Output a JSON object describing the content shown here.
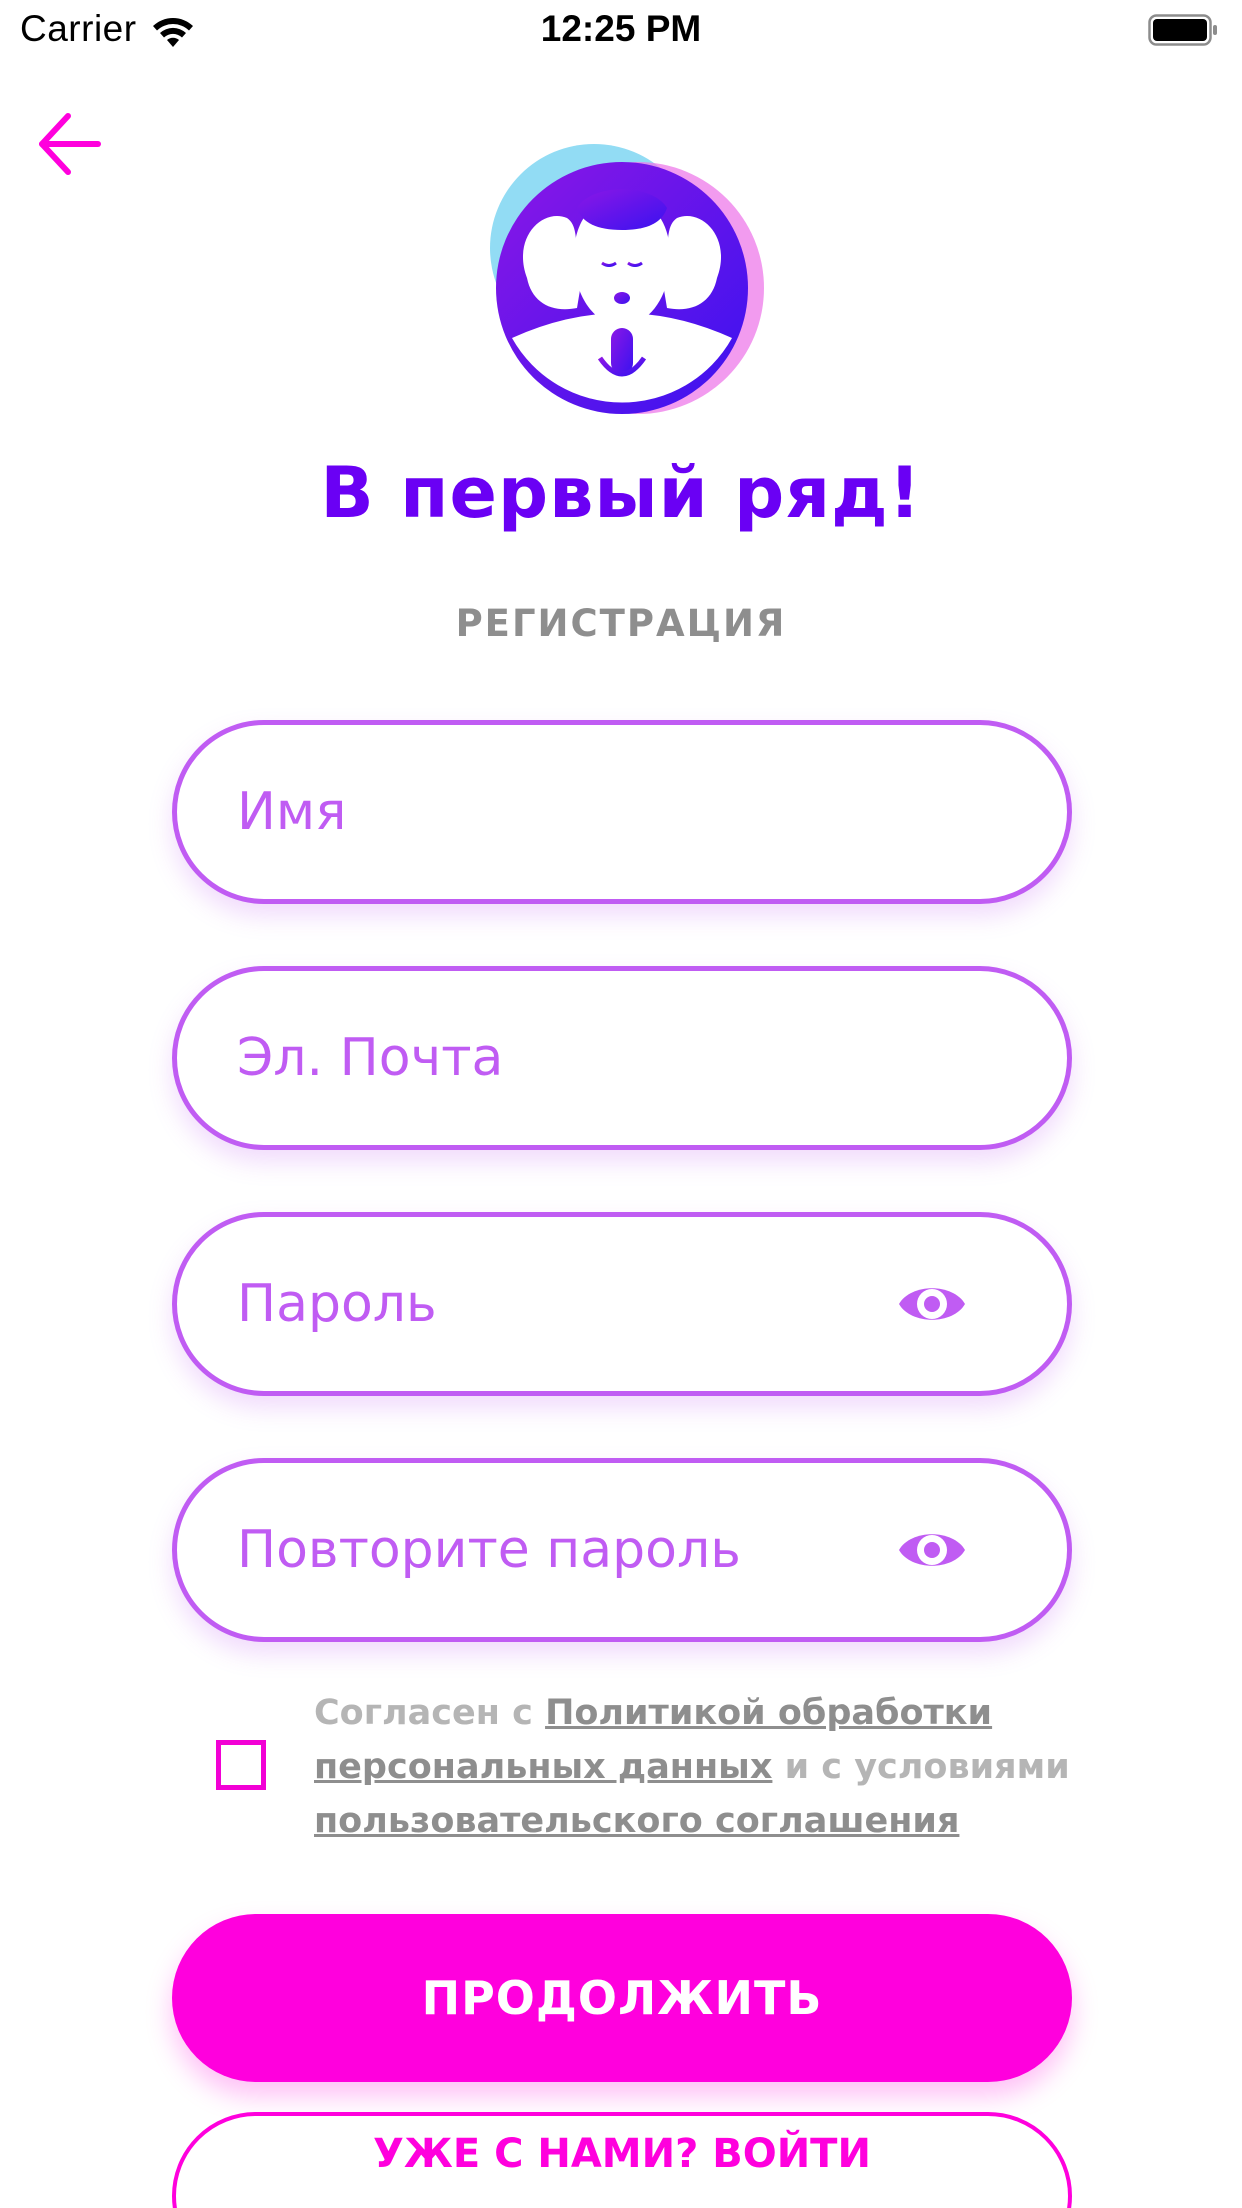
{
  "status_bar": {
    "carrier": "Carrier",
    "time": "12:25 PM"
  },
  "header": {
    "back_icon": "arrow-left-icon",
    "logo_icon": "singers-microphone-logo",
    "app_title": "В первый ряд!",
    "screen_title": "РЕГИСТРАЦИЯ"
  },
  "form": {
    "name_placeholder": "Имя",
    "name_value": "",
    "email_placeholder": "Эл. Почта",
    "email_value": "",
    "password_placeholder": "Пароль",
    "password_value": "",
    "repeat_password_placeholder": "Повторите пароль",
    "repeat_password_value": "",
    "eye_icon": "eye-icon"
  },
  "agreement": {
    "checked": false,
    "prefix": "Согласен с ",
    "policy_link": "Политикой обработки персональных данных",
    "middle": " и с условиями ",
    "terms_link": "пользовательского соглашения"
  },
  "actions": {
    "continue_label": "ПРОДОЛЖИТЬ",
    "login_label": "УЖЕ С НАМИ? ВОЙТИ"
  },
  "colors": {
    "accent": "#ff00dd",
    "field_border": "#c05cf3",
    "title_purple": "#6a00f4",
    "muted_gray": "#8e8e8e"
  }
}
